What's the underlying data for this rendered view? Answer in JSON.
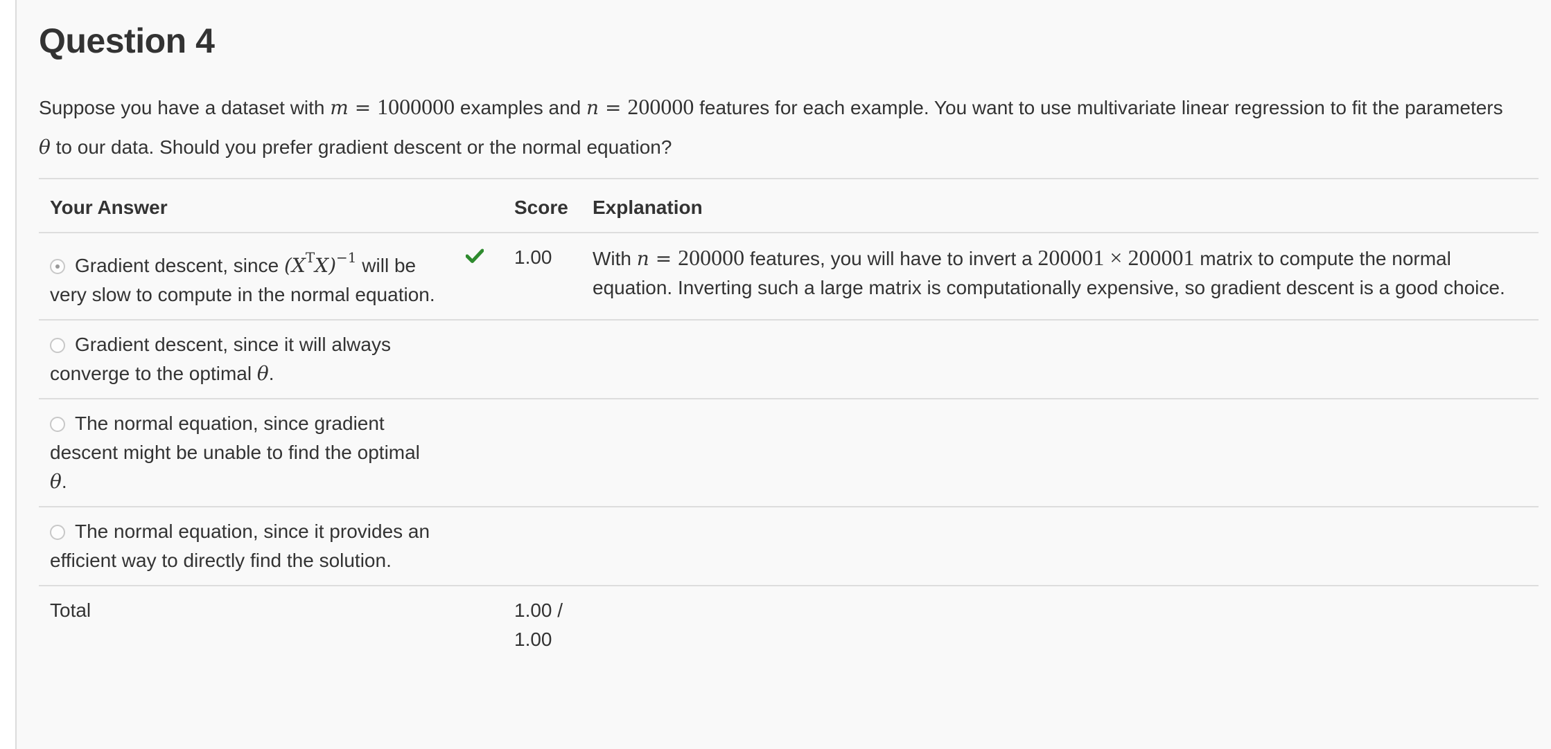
{
  "question": {
    "title": "Question 4",
    "text_part1": "Suppose you have a dataset with ",
    "m_var": "m",
    "m_eq": " = ",
    "m_val": "1000000",
    "text_part2": " examples and ",
    "n_var": "n",
    "n_eq": " = ",
    "n_val": "200000",
    "text_part3": " features for each example. You want to use multivariate linear regression to fit the parameters ",
    "theta": "θ",
    "text_part4": " to our data. Should you prefer gradient descent or the normal equation?"
  },
  "table": {
    "headers": {
      "answer": "Your Answer",
      "score": "Score",
      "explanation": "Explanation"
    },
    "options": [
      {
        "text_before": "Gradient descent, since ",
        "math_base": "(X",
        "math_sup1": "T",
        "math_mid": "X)",
        "math_sup2": "−1",
        "text_after": " will be very slow to compute in the normal equation.",
        "selected": true,
        "score": "1.00",
        "explanation_1": "With ",
        "expl_n": "n",
        "expl_eq": " = ",
        "expl_nval": "200000",
        "explanation_2": " features, you will have to invert a ",
        "expl_dim": "200001 × 200001",
        "explanation_3": " matrix to compute the normal equation. Inverting such a large matrix is computationally expensive, so gradient descent is a good choice."
      },
      {
        "text": "Gradient descent, since it will always converge to the optimal ",
        "theta": "θ",
        "end": ".",
        "selected": false
      },
      {
        "text": "The normal equation, since gradient descent might be unable to find the optimal ",
        "theta": "θ",
        "end": ".",
        "selected": false
      },
      {
        "text": "The normal equation, since it provides an efficient way to directly find the solution.",
        "selected": false
      }
    ],
    "total": {
      "label": "Total",
      "score": "1.00 / 1.00"
    }
  },
  "colors": {
    "check": "#2e8b2e",
    "text": "#333333",
    "panel_bg": "#f9f9f9"
  },
  "icons": {
    "correct": "check-icon"
  }
}
